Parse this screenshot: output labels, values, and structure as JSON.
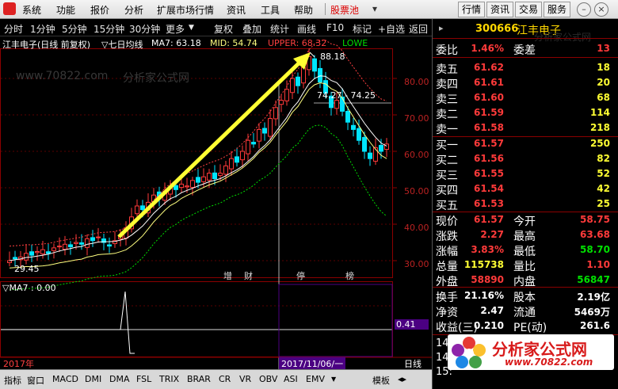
{
  "menu": {
    "items": [
      "系统",
      "功能",
      "报价",
      "分析",
      "扩展市场行情",
      "资讯",
      "工具",
      "帮助",
      "股票池"
    ],
    "right_buttons": [
      "行情",
      "资讯",
      "交易",
      "服务"
    ]
  },
  "toolbar": {
    "periods": [
      "分时",
      "1分钟",
      "5分钟",
      "15分钟",
      "30分钟",
      "更多"
    ],
    "tools": [
      "复权",
      "叠加",
      "统计",
      "画线",
      "F10",
      "标记",
      "+自选",
      "返回"
    ]
  },
  "chart": {
    "header": {
      "title": "江丰电子(日线 前复权)",
      "ma_label": "▽七日均线",
      "ma7": "MA7: 63.18",
      "mid": "MID: 54.74",
      "upper": "UPPER: 68.32",
      "lower": "LOWE"
    },
    "price_ticks": [
      "80.00",
      "70.00",
      "60.00",
      "50.00",
      "40.00",
      "30.00"
    ],
    "high_label": "88.18",
    "low_label": "29.45",
    "range_label": "74.27 - 74.25",
    "event_marks": [
      "增",
      "财",
      "停",
      "榜"
    ],
    "indicator_header": "▽MA7 : 0.00",
    "indicator_value": "0.41",
    "date_left": "2017年",
    "date_cursor": "2017/11/06/一",
    "bottom_right": "日线",
    "watermark": "分析家公式网",
    "watermark2": "www.70822.com",
    "colors": {
      "up": "#ff3a3a",
      "down": "#00e5ff",
      "ma": "#ffffff",
      "mid": "#ffff80",
      "upper": "#ff4040",
      "lower": "#00dd00",
      "arrow": "#ffff33"
    }
  },
  "indicator_tabs": [
    "指标",
    "窗口",
    "MACD",
    "DMI",
    "DMA",
    "FSL",
    "TRIX",
    "BRAR",
    "CR",
    "VR",
    "OBV",
    "ASI",
    "EMV",
    "模板"
  ],
  "quote": {
    "code": "300666",
    "name": "江丰电子",
    "weibi": {
      "label": "委比",
      "value": "1.46%",
      "label2": "委差",
      "value2": "13"
    },
    "sell": [
      {
        "label": "卖五",
        "price": "61.62",
        "vol": "18"
      },
      {
        "label": "卖四",
        "price": "61.61",
        "vol": "20"
      },
      {
        "label": "卖三",
        "price": "61.60",
        "vol": "68"
      },
      {
        "label": "卖二",
        "price": "61.59",
        "vol": "114"
      },
      {
        "label": "卖一",
        "price": "61.58",
        "vol": "218"
      }
    ],
    "buy": [
      {
        "label": "买一",
        "price": "61.57",
        "vol": "250"
      },
      {
        "label": "买二",
        "price": "61.56",
        "vol": "82"
      },
      {
        "label": "买三",
        "price": "61.55",
        "vol": "52"
      },
      {
        "label": "买四",
        "price": "61.54",
        "vol": "42"
      },
      {
        "label": "买五",
        "price": "61.53",
        "vol": "25"
      }
    ],
    "stats": [
      {
        "l1": "现价",
        "v1": "61.57",
        "l2": "今开",
        "v2": "58.75"
      },
      {
        "l1": "涨跌",
        "v1": "2.27",
        "l2": "最高",
        "v2": "63.68"
      },
      {
        "l1": "涨幅",
        "v1": "3.83%",
        "l2": "最低",
        "v2": "58.70"
      },
      {
        "l1": "总量",
        "v1": "115738",
        "l2": "量比",
        "v2": "1.10"
      },
      {
        "l1": "外盘",
        "v1": "58890",
        "l2": "内盘",
        "v2": "56847"
      }
    ],
    "stats2": [
      {
        "l1": "换手",
        "v1": "21.16%",
        "l2": "股本",
        "v2": "2.19亿"
      },
      {
        "l1": "净资",
        "v1": "2.47",
        "l2": "流通",
        "v2": "5469万"
      },
      {
        "l1": "收益(三)",
        "v1": "0.210",
        "l2": "PE(动)",
        "v2": "261.6"
      }
    ],
    "ticks": [
      "14:",
      "14:",
      "15:"
    ],
    "logo_text": "分析家公式网",
    "logo_url": "www.70822.com"
  }
}
